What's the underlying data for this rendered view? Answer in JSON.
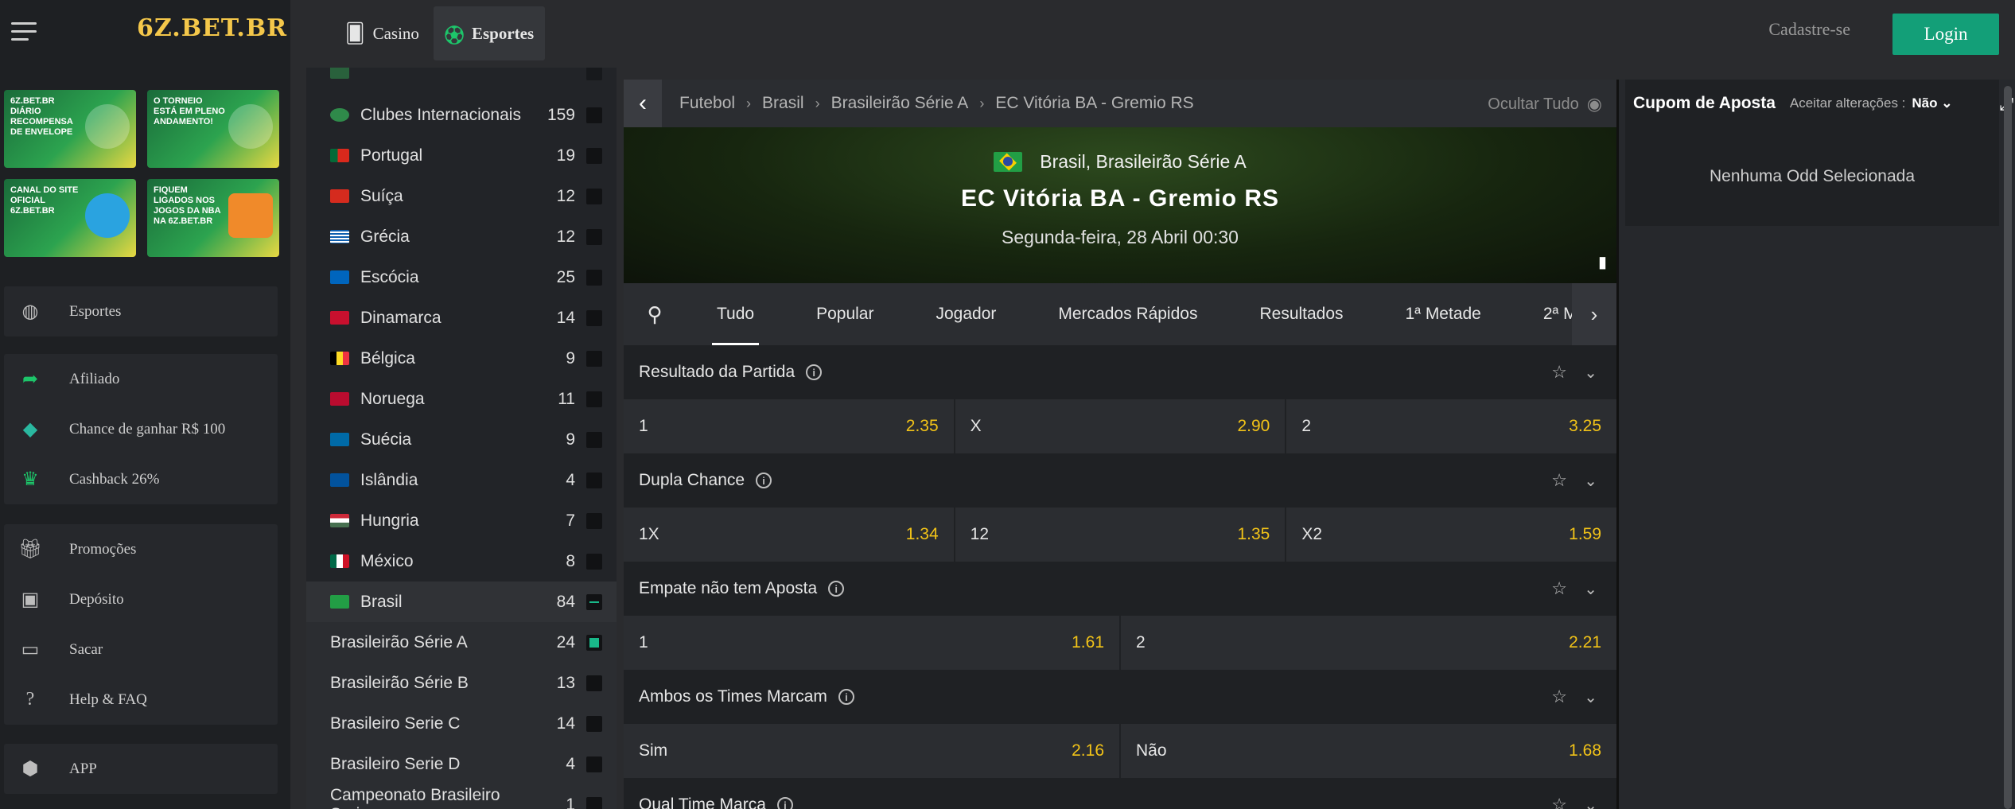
{
  "brand": {
    "logo": "6Z.BET.BR"
  },
  "banners": [
    {
      "text": "6Z.BET.BR DIÁRIO RECOMPENSA DE ENVELOPE"
    },
    {
      "text": "O TORNEIO ESTÁ EM PLENO ANDAMENTO!"
    },
    {
      "text": "CANAL DO SITE OFICIAL 6Z.BET.BR"
    },
    {
      "text": "FIQUEM LIGADOS NOS JOGOS DA NBA NA 6Z.BET.BR"
    }
  ],
  "leftnav": {
    "sports": "Esportes",
    "affiliate": "Afiliado",
    "chance": "Chance de ganhar R$ 100",
    "cashback": "Cashback 26%",
    "promos": "Promoções",
    "deposit": "Depósito",
    "withdraw": "Sacar",
    "help": "Help & FAQ",
    "app": "APP"
  },
  "topbar": {
    "casino": "Casino",
    "sports": "Esportes",
    "signup": "Cadastre-se",
    "login": "Login"
  },
  "countries": [
    {
      "name": "Clubes Internacionais",
      "count": "159"
    },
    {
      "name": "Portugal",
      "count": "19"
    },
    {
      "name": "Suíça",
      "count": "12"
    },
    {
      "name": "Grécia",
      "count": "12"
    },
    {
      "name": "Escócia",
      "count": "25"
    },
    {
      "name": "Dinamarca",
      "count": "14"
    },
    {
      "name": "Bélgica",
      "count": "9"
    },
    {
      "name": "Noruega",
      "count": "11"
    },
    {
      "name": "Suécia",
      "count": "9"
    },
    {
      "name": "Islândia",
      "count": "4"
    },
    {
      "name": "Hungria",
      "count": "7"
    },
    {
      "name": "México",
      "count": "8"
    },
    {
      "name": "Brasil",
      "count": "84"
    }
  ],
  "leagues": [
    {
      "name": "Brasileirão Série A",
      "count": "24"
    },
    {
      "name": "Brasileirão Série B",
      "count": "13"
    },
    {
      "name": "Brasileiro Serie C",
      "count": "14"
    },
    {
      "name": "Brasileiro Serie D",
      "count": "4"
    },
    {
      "name": "Campeonato Brasileiro Serie ...",
      "count": "1"
    }
  ],
  "breadcrumb": {
    "items": [
      "Futebol",
      "Brasil",
      "Brasileirão Série A",
      "EC Vitória BA - Gremio RS"
    ],
    "hide_all": "Ocultar Tudo"
  },
  "match": {
    "competition": "Brasil, Brasileirão Série A",
    "teams": "EC Vitória BA  -  Gremio RS",
    "date": "Segunda-feira, 28 Abril 00:30"
  },
  "tabs": [
    "Tudo",
    "Popular",
    "Jogador",
    "Mercados Rápidos",
    "Resultados",
    "1ª Metade",
    "2ª M"
  ],
  "markets": [
    {
      "title": "Resultado da Partida",
      "odds": [
        {
          "label": "1",
          "value": "2.35"
        },
        {
          "label": "X",
          "value": "2.90"
        },
        {
          "label": "2",
          "value": "3.25"
        }
      ]
    },
    {
      "title": "Dupla Chance",
      "odds": [
        {
          "label": "1X",
          "value": "1.34"
        },
        {
          "label": "12",
          "value": "1.35"
        },
        {
          "label": "X2",
          "value": "1.59"
        }
      ]
    },
    {
      "title": "Empate não tem Aposta",
      "odds": [
        {
          "label": "1",
          "value": "1.61"
        },
        {
          "label": "2",
          "value": "2.21"
        }
      ]
    },
    {
      "title": "Ambos os Times Marcam",
      "odds": [
        {
          "label": "Sim",
          "value": "2.16"
        },
        {
          "label": "Não",
          "value": "1.68"
        }
      ]
    },
    {
      "title": "Qual Time Marca"
    }
  ],
  "betslip": {
    "title": "Cupom de Aposta",
    "accept_label": "Aceitar alterações :",
    "accept_value": "Não",
    "empty": "Nenhuma Odd Selecionada"
  },
  "colors": {
    "accent": "#139f78",
    "odd": "#f2c318"
  }
}
